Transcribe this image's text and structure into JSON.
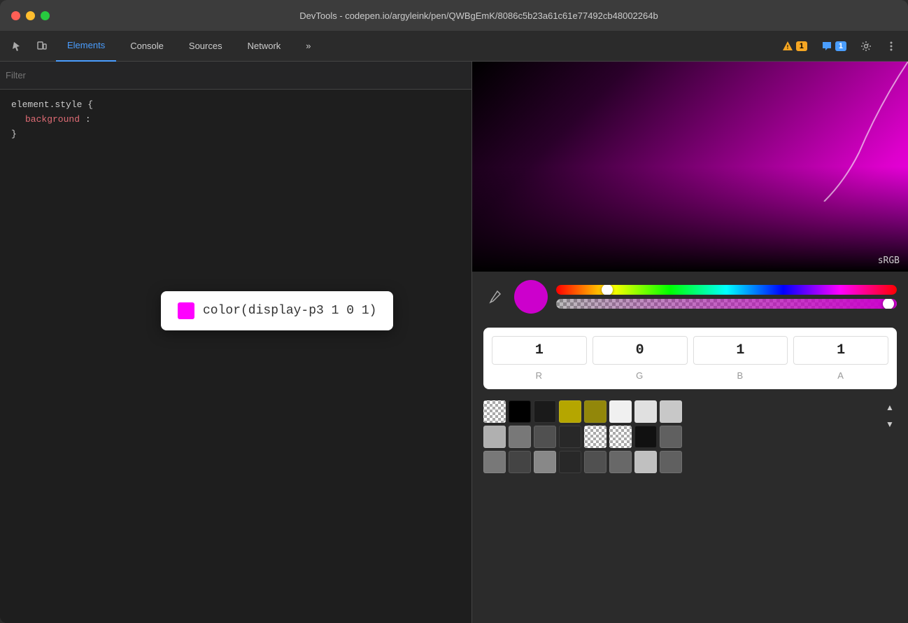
{
  "window": {
    "title": "DevTools - codepen.io/argyleink/pen/QWBgEmK/8086c5b23a61c61e77492cb48002264b"
  },
  "tabs": {
    "items": [
      {
        "id": "elements",
        "label": "Elements",
        "active": true
      },
      {
        "id": "console",
        "label": "Console",
        "active": false
      },
      {
        "id": "sources",
        "label": "Sources",
        "active": false
      },
      {
        "id": "network",
        "label": "Network",
        "active": false
      }
    ],
    "more_label": "»"
  },
  "toolbar": {
    "warning_count": "1",
    "chat_count": "1"
  },
  "filter": {
    "placeholder": "Filter"
  },
  "code": {
    "selector": "element.style {",
    "property": "background",
    "value": "color(display-p3 1 0 1)",
    "close_brace": "}"
  },
  "tooltip": {
    "color_value": "color(display-p3 1 0 1)",
    "swatch_color": "#ff00ff"
  },
  "color_picker": {
    "srgb_label": "sRGB",
    "r_value": "1",
    "g_value": "0",
    "b_value": "1",
    "a_value": "1",
    "r_label": "R",
    "g_label": "G",
    "b_label": "B",
    "a_label": "A"
  },
  "swatches": {
    "rows": [
      [
        "checker",
        "#000000",
        "#1a1a1a",
        "#b5a600",
        "#b5a600c0",
        "#f0f0f0",
        "#e0e0e0",
        "#c8c8c8"
      ],
      [
        "#b0b0b0",
        "#787878",
        "#505050",
        "#282828",
        "checker2",
        "checker3",
        "#111111",
        "#606060"
      ],
      [
        "#787878",
        "#444444",
        "#888888",
        "#282828",
        "#505050",
        "#686868",
        "#c0c0c0",
        "#606060"
      ]
    ]
  }
}
